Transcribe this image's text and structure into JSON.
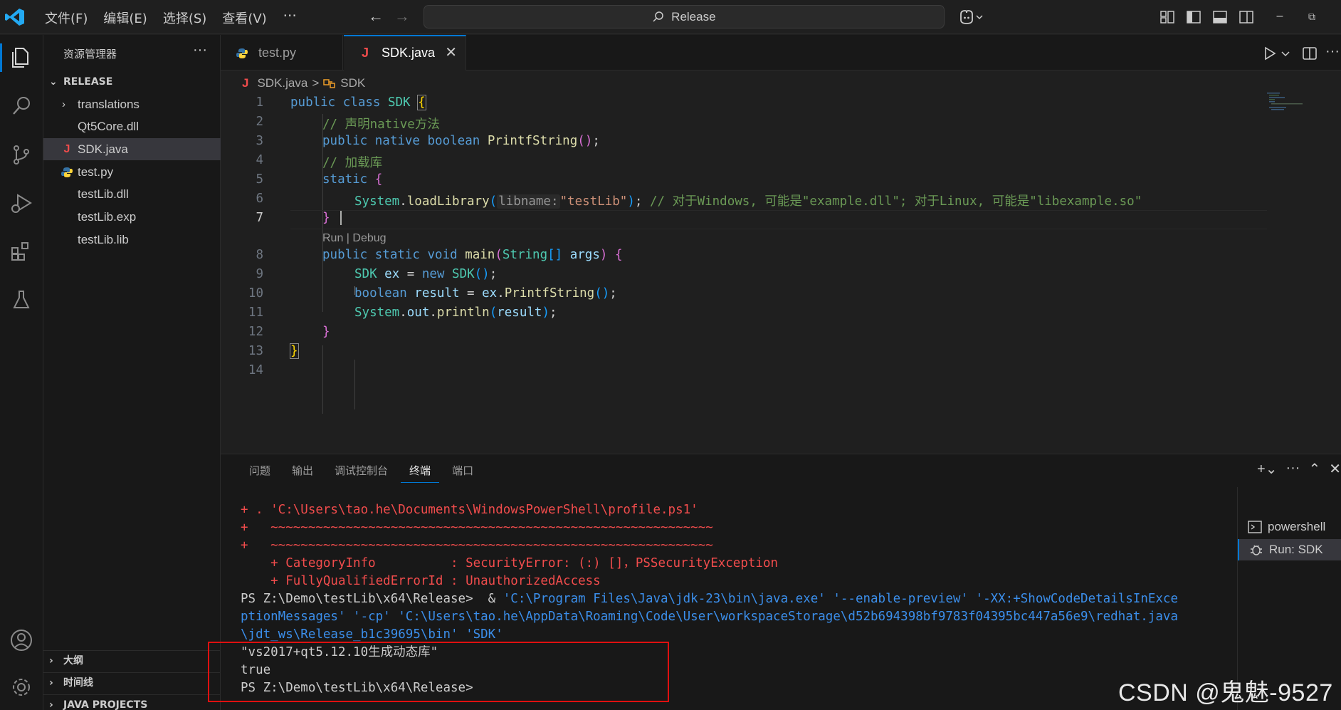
{
  "titlebar": {
    "menu": [
      "文件(F)",
      "编辑(E)",
      "选择(S)",
      "查看(V)"
    ],
    "more": "···",
    "search_text": "Release",
    "min": "–",
    "restore": "⧉"
  },
  "sidebar": {
    "title": "资源管理器",
    "more": "···",
    "root": "RELEASE",
    "items": [
      {
        "label": "translations",
        "kind": "folder"
      },
      {
        "label": "Qt5Core.dll",
        "kind": "file"
      },
      {
        "label": "SDK.java",
        "kind": "java"
      },
      {
        "label": "test.py",
        "kind": "python"
      },
      {
        "label": "testLib.dll",
        "kind": "file"
      },
      {
        "label": "testLib.exp",
        "kind": "file"
      },
      {
        "label": "testLib.lib",
        "kind": "file"
      }
    ],
    "bottom_sections": [
      "大纲",
      "时间线",
      "JAVA PROJECTS"
    ]
  },
  "tabs": [
    {
      "label": "test.py",
      "icon": "python-icon"
    },
    {
      "label": "SDK.java",
      "icon": "java-icon",
      "active": true
    }
  ],
  "breadcrumb": {
    "file": "SDK.java",
    "symbol": "SDK",
    "sep": ">"
  },
  "editor": {
    "line_numbers": [
      "1",
      "2",
      "3",
      "4",
      "5",
      "6",
      "7",
      "8",
      "9",
      "10",
      "11",
      "12",
      "13",
      "14"
    ],
    "codelens": "Run | Debug",
    "param_hint": "libname:",
    "lines": {
      "l1": [
        "public class ",
        "SDK",
        " ",
        "{"
      ],
      "l2": "// 声明native方法",
      "l3": [
        "public native ",
        "boolean",
        " ",
        "PrintfString",
        "(",
        ")",
        ";"
      ],
      "l4": "// 加载库",
      "l5": [
        "static ",
        "{"
      ],
      "l6": [
        "System",
        ".",
        "loadLibrary",
        "(",
        "\"testLib\"",
        ")",
        "; ",
        "// 对于Windows, 可能是\"example.dll\"; 对于Linux, 可能是\"libexample.so\""
      ],
      "l7": "}",
      "l8": [
        "public static ",
        "void ",
        "main",
        "(",
        "String",
        "[] ",
        "args",
        ") ",
        "{"
      ],
      "l9": [
        "SDK ",
        "ex",
        " = ",
        "new ",
        "SDK",
        "(",
        ")",
        ";"
      ],
      "l10": [
        "boolean ",
        "result",
        " = ",
        "ex",
        ".",
        "PrintfString",
        "(",
        ")",
        ";"
      ],
      "l11": [
        "System",
        ".",
        "out",
        ".",
        "println",
        "(",
        "result",
        ")",
        ";"
      ],
      "l12": "}",
      "l13": "}"
    }
  },
  "panel": {
    "tabs": [
      "问题",
      "输出",
      "调试控制台",
      "终端",
      "端口"
    ],
    "active_tab": "终端",
    "terminal_lines": [
      "+ . 'C:\\Users\\tao.he\\Documents\\WindowsPowerShell\\profile.ps1'",
      "+   ~~~~~~~~~~~~~~~~~~~~~~~~~~~~~~~~~~~~~~~~~~~~~~~~~~~~~~~~~~~",
      "+   ~~~~~~~~~~~~~~~~~~~~~~~~~~~~~~~~~~~~~~~~~~~~~~~~~~~~~~~~~~~",
      "    + CategoryInfo          : SecurityError: (:) []，PSSecurityException",
      "    + FullyQualifiedErrorId : UnauthorizedAccess"
    ],
    "prompt_cmd": "PS Z:\\Demo\\testLib\\x64\\Release>  & ",
    "cmd_part1": "'C:\\Program Files\\Java\\jdk-23\\bin\\java.exe' '--enable-preview' '-XX:+ShowCodeDetailsInExce",
    "cmd_part2": "ptionMessages' '-cp' 'C:\\Users\\tao.he\\AppData\\Roaming\\Code\\User\\workspaceStorage\\d52b694398bf9783f04395bc447a56e9\\redhat.java",
    "cmd_part3": "\\jdt_ws\\Release_b1c39695\\bin' 'SDK'",
    "output1": "\"vs2017+qt5.12.10生成动态库\"",
    "output2": "true",
    "final_prompt": "PS Z:\\Demo\\testLib\\x64\\Release>",
    "terminals": [
      "powershell",
      "Run: SDK"
    ]
  },
  "watermark": "CSDN @鬼魅-9527",
  "colors": {
    "accent": "#0078d4",
    "highlight_box": "#e01010",
    "error_text": "#f14c4c"
  }
}
